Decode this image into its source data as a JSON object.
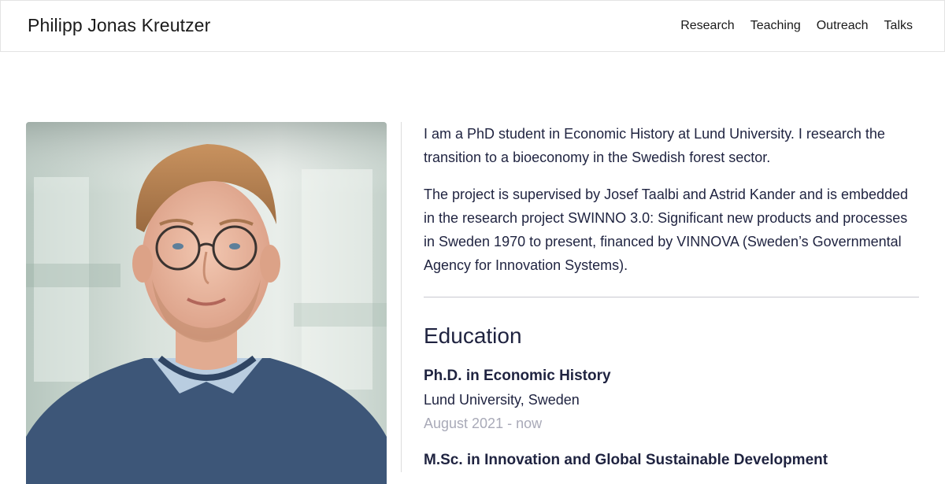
{
  "header": {
    "site_title": "Philipp Jonas Kreutzer",
    "nav": [
      "Research",
      "Teaching",
      "Outreach",
      "Talks"
    ]
  },
  "intro": {
    "paragraphs": [
      "I am a PhD student in Economic History at Lund University. I research the transition to a bioeconomy in the Swedish forest sector.",
      "The project is supervised by Josef Taalbi and Astrid Kander and is embedded in the research project SWINNO 3.0: Significant new products and processes in Sweden 1970 to present, financed by VINNOVA (Sweden’s Governmental Agency for Innovation Systems)."
    ]
  },
  "education": {
    "title": "Education",
    "items": [
      {
        "degree": "Ph.D. in Economic History",
        "institution": "Lund University, Sweden",
        "dates": "August 2021 - now"
      },
      {
        "degree": "M.Sc. in Innovation and Global Sustainable Development",
        "institution": "",
        "dates": ""
      }
    ]
  },
  "colors": {
    "text": "#1f2340",
    "muted": "#a9aab8",
    "sweater": "#3d5678",
    "background_blur": "#c9d6d0"
  }
}
